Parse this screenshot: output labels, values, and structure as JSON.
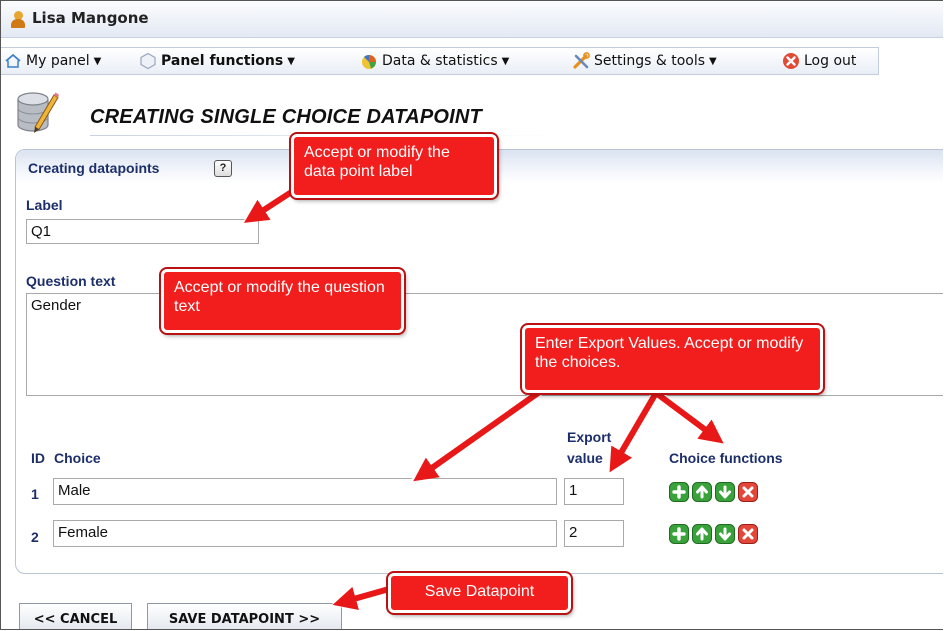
{
  "user": {
    "name": "Lisa Mangone"
  },
  "menu": [
    {
      "label": "My panel",
      "bold": false,
      "icon": "home-icon"
    },
    {
      "label": "Panel functions",
      "bold": true,
      "icon": "hexagon-icon"
    },
    {
      "label": "Data & statistics",
      "bold": false,
      "icon": "chart-icon"
    },
    {
      "label": "Settings & tools",
      "bold": false,
      "icon": "tools-icon"
    },
    {
      "label": "Log out",
      "bold": false,
      "icon": "logout-icon"
    }
  ],
  "page": {
    "title": "CREATING SINGLE CHOICE DATAPOINT"
  },
  "panel": {
    "title": "Creating datapoints",
    "help": "?",
    "label_label": "Label",
    "label_value": "Q1",
    "question_label": "Question text",
    "question_value": "Gender"
  },
  "choices": {
    "col_id": "ID",
    "col_choice": "Choice",
    "col_export_1": "Export",
    "col_export_2": "value",
    "col_functions": "Choice functions",
    "rows": [
      {
        "id": "1",
        "choice": "Male",
        "export": "1"
      },
      {
        "id": "2",
        "choice": "Female",
        "export": "2"
      }
    ]
  },
  "buttons": {
    "cancel": "<< CANCEL",
    "save": "SAVE DATAPOINT >>"
  },
  "callouts": {
    "label": "Accept or modify the data point label",
    "question": "Accept or modify the question text",
    "export": "Enter Export Values.  Accept or modify the choices.",
    "save": "Save Datapoint"
  },
  "colors": {
    "callout": "#f21d1d",
    "heading": "#1d2f6a",
    "func_green": "#3aa23a",
    "func_red": "#e2473a"
  }
}
